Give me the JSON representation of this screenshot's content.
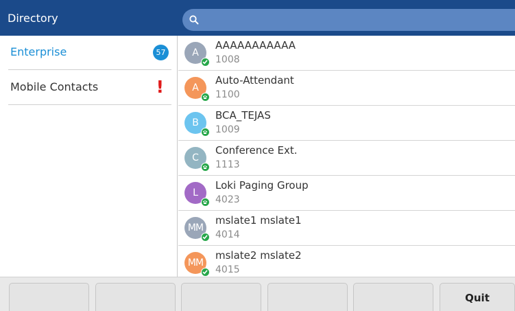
{
  "header": {
    "title": "Directory",
    "search_placeholder": ""
  },
  "sidebar": {
    "items": [
      {
        "label": "Enterprise",
        "badge": "57",
        "active": true
      },
      {
        "label": "Mobile Contacts",
        "alert": "!"
      }
    ]
  },
  "contacts": [
    {
      "initials": "A",
      "name": "AAAAAAAAAAA",
      "ext": "1008",
      "avatar_color": "#9aa6b8",
      "presence": "available"
    },
    {
      "initials": "A",
      "name": "Auto-Attendant",
      "ext": "1100",
      "avatar_color": "#f4965a",
      "presence": "phone"
    },
    {
      "initials": "B",
      "name": "BCA_TEJAS",
      "ext": "1009",
      "avatar_color": "#6cc4ef",
      "presence": "phone"
    },
    {
      "initials": "C",
      "name": "Conference Ext.",
      "ext": "1113",
      "avatar_color": "#93b5c2",
      "presence": "phone"
    },
    {
      "initials": "L",
      "name": "Loki Paging Group",
      "ext": "4023",
      "avatar_color": "#a26ac6",
      "presence": "phone"
    },
    {
      "initials": "MM",
      "name": "mslate1 mslate1",
      "ext": "4014",
      "avatar_color": "#9aa6b8",
      "presence": "available"
    },
    {
      "initials": "MM",
      "name": "mslate2 mslate2",
      "ext": "4015",
      "avatar_color": "#f4965a",
      "presence": "available"
    }
  ],
  "softkeys": [
    "",
    "",
    "",
    "",
    "",
    "Quit"
  ],
  "colors": {
    "header_bg": "#1b4a8a",
    "accent": "#1b8fd6",
    "alert": "#e01b1b",
    "presence_green": "#27a74a"
  }
}
